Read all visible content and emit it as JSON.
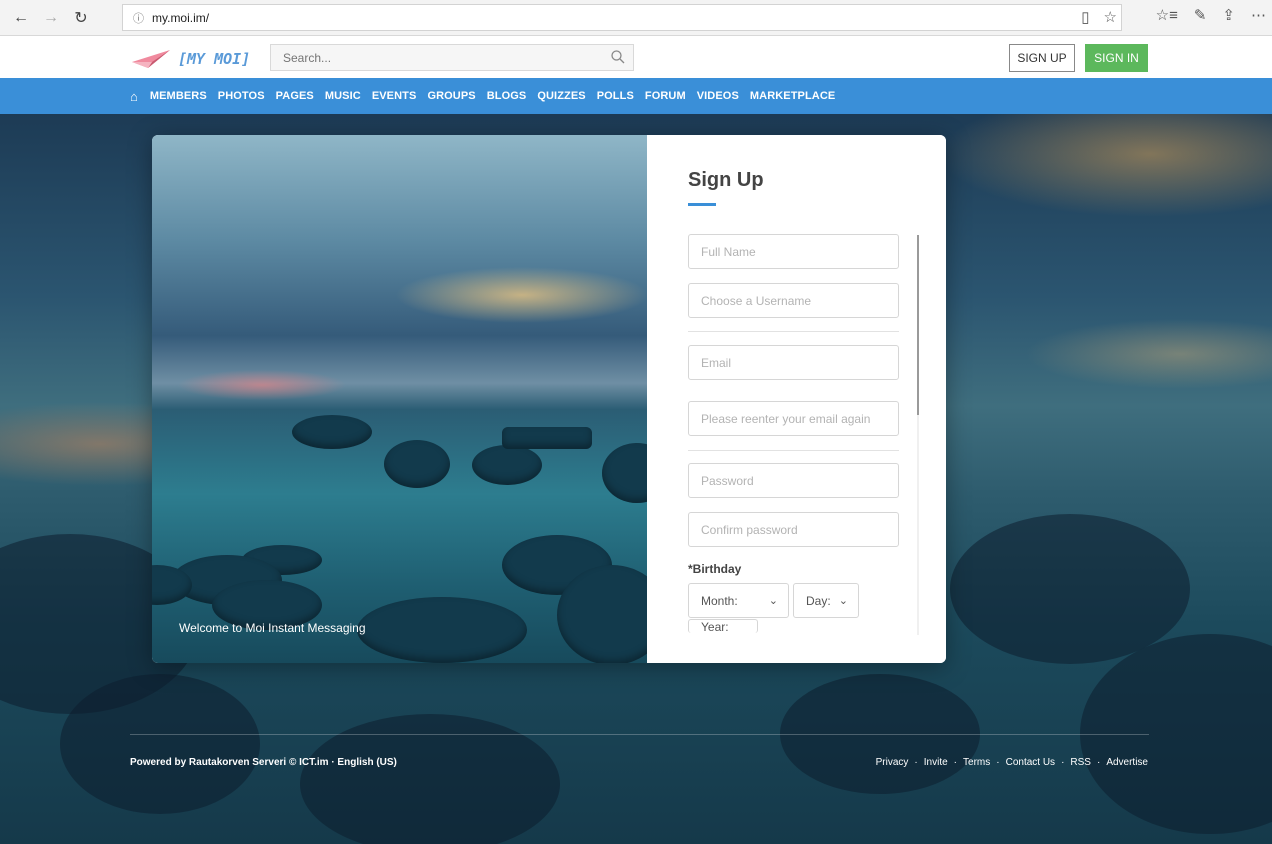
{
  "browser": {
    "url": "my.moi.im/",
    "icons": [
      "back-icon",
      "forward-icon",
      "refresh-icon",
      "reading-view-icon",
      "favorite-star-icon",
      "favorites-list-icon",
      "pen-icon",
      "share-icon",
      "more-icon"
    ]
  },
  "header": {
    "logo_text": "[MY MOI]",
    "search_placeholder": "Search...",
    "signup_label": "SIGN UP",
    "signin_label": "SIGN IN",
    "signin_color": "#5cb85c"
  },
  "menu": {
    "accent_color": "#3a8fd8",
    "items": [
      "MEMBERS",
      "PHOTOS",
      "PAGES",
      "MUSIC",
      "EVENTS",
      "GROUPS",
      "BLOGS",
      "QUIZZES",
      "POLLS",
      "FORUM",
      "VIDEOS",
      "MARKETPLACE"
    ]
  },
  "card": {
    "welcome_text": "Welcome to Moi Instant Messaging",
    "form_title": "Sign Up",
    "fields": {
      "full_name": "Full Name",
      "username": "Choose a Username",
      "email": "Email",
      "email_confirm": "Please reenter your email again",
      "password": "Password",
      "password_confirm": "Confirm password"
    },
    "birthday_label": "*Birthday",
    "month_label": "Month:",
    "day_label": "Day:",
    "year_label": "Year:"
  },
  "footer": {
    "left_text": "Powered by Rautakorven Serveri © ICT.im · English (US)",
    "links": [
      "Privacy",
      "Invite",
      "Terms",
      "Contact Us",
      "RSS",
      "Advertise"
    ]
  }
}
